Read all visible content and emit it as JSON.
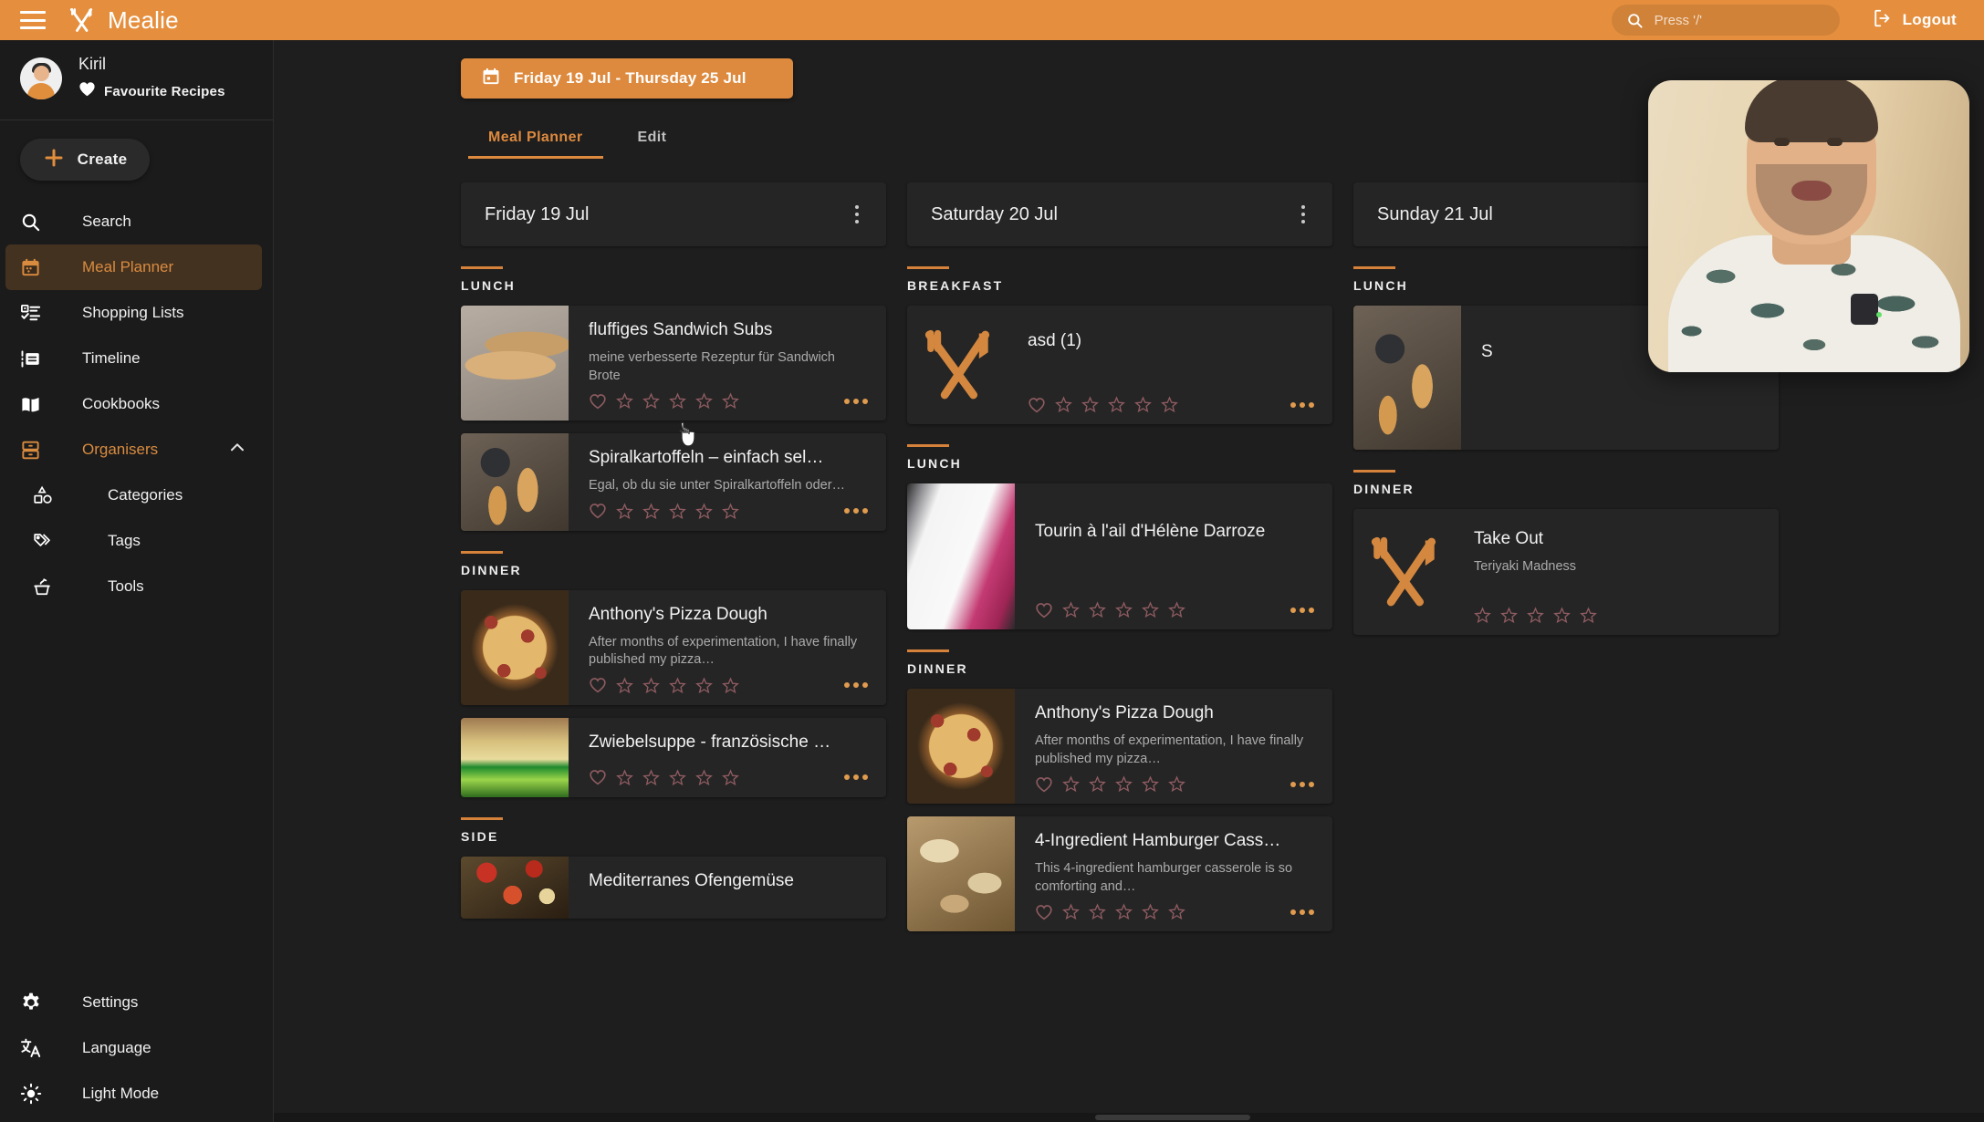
{
  "app": {
    "brand": "Mealie",
    "logo_icon": "fork-knife-icon",
    "menu_icon": "hamburger-menu-icon"
  },
  "search": {
    "placeholder": "Press '/'",
    "value": "",
    "icon": "search-icon"
  },
  "logout": {
    "label": "Logout",
    "icon": "logout-icon"
  },
  "sidebar": {
    "user": {
      "name": "Kiril",
      "favourite_label": "Favourite Recipes",
      "heart_icon": "heart-icon",
      "avatar_icon": "avatar"
    },
    "create": {
      "label": "Create",
      "icon": "plus-icon"
    },
    "items": [
      {
        "label": "Search",
        "icon": "magnify-icon",
        "active": false
      },
      {
        "label": "Meal Planner",
        "icon": "calendar-icon",
        "active": true
      },
      {
        "label": "Shopping Lists",
        "icon": "checklist-icon",
        "active": false
      },
      {
        "label": "Timeline",
        "icon": "timeline-icon",
        "active": false
      },
      {
        "label": "Cookbooks",
        "icon": "book-open-icon",
        "active": false
      },
      {
        "label": "Organisers",
        "icon": "organiser-icon",
        "active": false,
        "expanded": true
      }
    ],
    "sub_items": [
      {
        "label": "Categories",
        "icon": "shapes-icon"
      },
      {
        "label": "Tags",
        "icon": "tag-icon"
      },
      {
        "label": "Tools",
        "icon": "tools-pot-icon"
      }
    ],
    "bottom_items": [
      {
        "label": "Settings",
        "icon": "gear-icon"
      },
      {
        "label": "Language",
        "icon": "translate-icon"
      },
      {
        "label": "Light Mode",
        "icon": "sun-icon"
      }
    ]
  },
  "toolbar": {
    "date_range": "Friday 19 Jul - Thursday 25 Jul",
    "date_range_icon": "calendar-icon"
  },
  "tabs": [
    {
      "label": "Meal Planner",
      "active": true
    },
    {
      "label": "Edit",
      "active": false
    }
  ],
  "colors": {
    "accent": "#E58F3E",
    "accent_dark": "#D6823A",
    "surface": "#252525",
    "background": "#1E1E1E",
    "sidebar": "#1B1B1B",
    "text": "#F0F0F0",
    "muted_text": "#ABABAB",
    "star": "#8E5B61",
    "heart": "#8E5B61"
  },
  "days": [
    {
      "title": "Friday 19 Jul",
      "menu_icon": "kebab-menu-icon",
      "sections": [
        {
          "label": "LUNCH",
          "entries": [
            {
              "title": "fluffiges Sandwich Subs",
              "description": "meine verbesserte Rezeptur für Sandwich Brote",
              "has_image": true,
              "image_kind": "bread-loaves",
              "rating": 0,
              "max_rating": 5,
              "favourite": false,
              "more_icon": "more-horizontal-icon"
            },
            {
              "title": "Spiralkartoffeln – einfach sel…",
              "description": "Egal, ob du sie unter Spiralkartoffeln oder…",
              "has_image": true,
              "image_kind": "spiral-potatoes",
              "rating": 0,
              "max_rating": 5,
              "favourite": false,
              "more_icon": "more-horizontal-icon"
            }
          ]
        },
        {
          "label": "DINNER",
          "entries": [
            {
              "title": "Anthony's Pizza Dough",
              "description": "After months of experimentation, I have finally published my pizza…",
              "has_image": true,
              "image_kind": "pizza",
              "rating": 0,
              "max_rating": 5,
              "favourite": false,
              "more_icon": "more-horizontal-icon"
            },
            {
              "title": "Zwiebelsuppe - französische …",
              "description": "",
              "has_image": true,
              "image_kind": "onion-soup",
              "rating": 0,
              "max_rating": 5,
              "favourite": false,
              "more_icon": "more-horizontal-icon"
            }
          ]
        },
        {
          "label": "SIDE",
          "entries": [
            {
              "title": "Mediterranes Ofengemüse",
              "description": "",
              "has_image": true,
              "image_kind": "roast-vegetables",
              "rating": 0,
              "max_rating": 5,
              "favourite": false,
              "more_icon": "more-horizontal-icon"
            }
          ]
        }
      ]
    },
    {
      "title": "Saturday 20 Jul",
      "menu_icon": "kebab-menu-icon",
      "sections": [
        {
          "label": "BREAKFAST",
          "entries": [
            {
              "title": "asd (1)",
              "description": "",
              "has_image": false,
              "image_kind": "fork-knife-placeholder",
              "rating": 0,
              "max_rating": 5,
              "favourite": false,
              "more_icon": "more-horizontal-icon"
            }
          ]
        },
        {
          "label": "LUNCH",
          "entries": [
            {
              "title": "Tourin à l'ail d'Hélène Darroze",
              "description": "",
              "has_image": true,
              "image_kind": "soup-plate",
              "rating": 0,
              "max_rating": 5,
              "favourite": false,
              "more_icon": "more-horizontal-icon"
            }
          ]
        },
        {
          "label": "DINNER",
          "entries": [
            {
              "title": "Anthony's Pizza Dough",
              "description": "After months of experimentation, I have finally published my pizza…",
              "has_image": true,
              "image_kind": "pizza",
              "rating": 0,
              "max_rating": 5,
              "favourite": false,
              "more_icon": "more-horizontal-icon"
            },
            {
              "title": "4-Ingredient Hamburger Cass…",
              "description": "This 4-ingredient hamburger casserole is so comforting and…",
              "has_image": true,
              "image_kind": "casserole",
              "rating": 0,
              "max_rating": 5,
              "favourite": false,
              "more_icon": "more-horizontal-icon"
            }
          ]
        }
      ]
    },
    {
      "title": "Sunday 21 Jul",
      "menu_icon": "kebab-menu-icon",
      "sections": [
        {
          "label": "LUNCH",
          "entries": [
            {
              "title": "S",
              "description": "",
              "has_image": true,
              "image_kind": "spiral-potatoes",
              "rating": 0,
              "max_rating": 5,
              "favourite": false,
              "more_icon": "more-horizontal-icon"
            }
          ]
        },
        {
          "label": "DINNER",
          "entries": [
            {
              "title": "Take Out",
              "description": "Teriyaki Madness",
              "has_image": false,
              "image_kind": "fork-knife-placeholder",
              "rating": 0,
              "max_rating": 5,
              "favourite": false,
              "has_favourite": false,
              "more_icon": "more-horizontal-icon"
            }
          ]
        }
      ]
    }
  ],
  "webcam": {
    "present": true,
    "description": "speaker video overlay"
  }
}
